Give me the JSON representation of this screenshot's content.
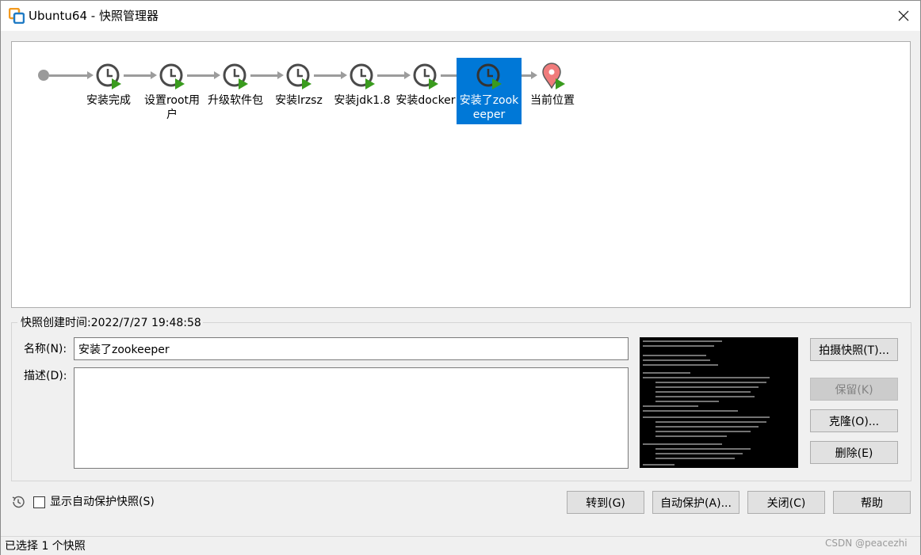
{
  "window": {
    "title": "Ubuntu64 - 快照管理器",
    "close_icon": "close-icon"
  },
  "snapshots": [
    {
      "label": "安装完成",
      "selected": false
    },
    {
      "label": "设置root用户",
      "selected": false
    },
    {
      "label": "升级软件包",
      "selected": false
    },
    {
      "label": "安装lrzsz",
      "selected": false
    },
    {
      "label": "安装jdk1.8",
      "selected": false
    },
    {
      "label": "安装docker",
      "selected": false
    },
    {
      "label": "安装了zookeeper",
      "selected": true
    }
  ],
  "current_position": {
    "label": "当前位置"
  },
  "details": {
    "caption": "快照创建时间:2022/7/27 19:48:58",
    "name_label": "名称(N):",
    "name_value": "安装了zookeeper",
    "desc_label": "描述(D):",
    "desc_value": ""
  },
  "side_buttons": {
    "take": "拍摄快照(T)...",
    "keep": "保留(K)",
    "clone": "克隆(O)...",
    "delete": "删除(E)"
  },
  "options": {
    "show_autoprotect_label": "显示自动保护快照(S)",
    "show_autoprotect_checked": false
  },
  "bottom_buttons": {
    "goto": "转到(G)",
    "autoprotect": "自动保护(A)...",
    "close": "关闭(C)",
    "help": "帮助"
  },
  "status": {
    "text": "已选择 1 个快照"
  },
  "watermark": "CSDN @peacezhi",
  "colors": {
    "selection": "#0078d7",
    "play_green": "#3a9b1e",
    "current_marker": "#f07b7b"
  }
}
